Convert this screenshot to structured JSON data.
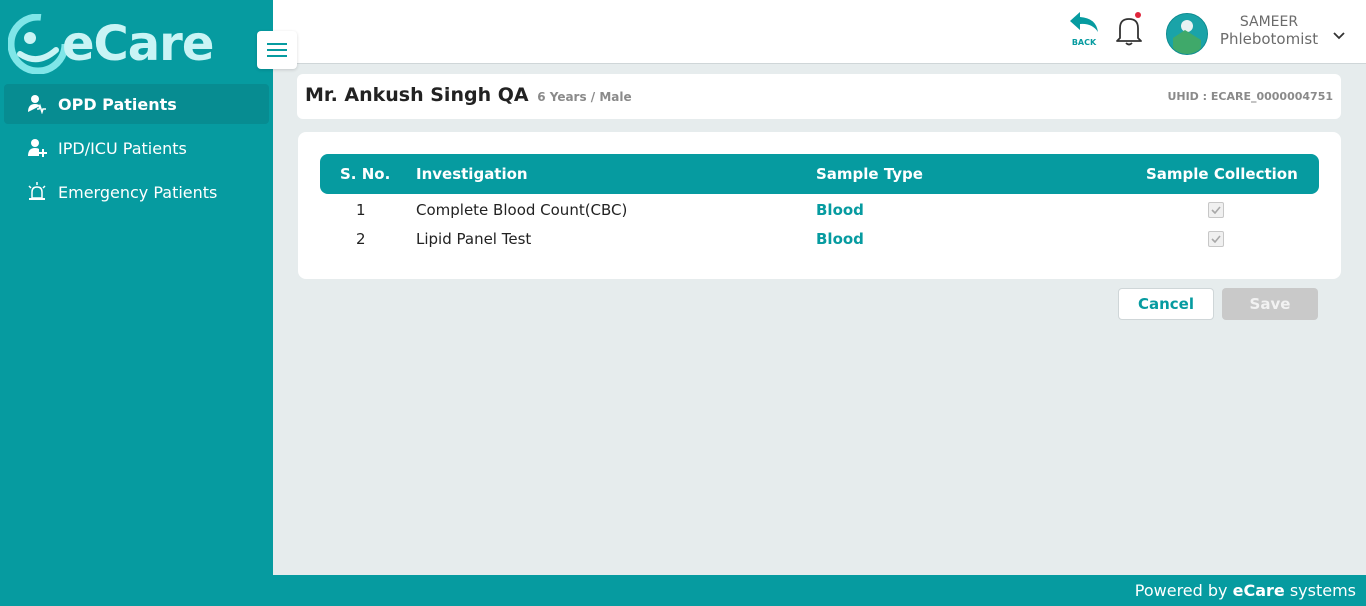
{
  "app": {
    "logo_text": "eCare"
  },
  "sidebar": {
    "items": [
      {
        "label": "OPD Patients",
        "icon": "user-pulse-icon",
        "active": true
      },
      {
        "label": "IPD/ICU Patients",
        "icon": "user-add-icon",
        "active": false
      },
      {
        "label": "Emergency Patients",
        "icon": "siren-icon",
        "active": false
      }
    ]
  },
  "header": {
    "back_label": "BACK",
    "user_name": "SAMEER",
    "user_role": "Phlebotomist"
  },
  "patient": {
    "name": "Mr. Ankush Singh QA",
    "meta": "6 Years / Male",
    "uhid": "UHID : ECARE_0000004751"
  },
  "table": {
    "headers": [
      "S. No.",
      "Investigation",
      "Sample Type",
      "Sample Collection"
    ],
    "rows": [
      {
        "sno": "1",
        "investigation": "Complete Blood Count(CBC)",
        "sample_type": "Blood",
        "collected": true
      },
      {
        "sno": "2",
        "investigation": "Lipid Panel Test",
        "sample_type": "Blood",
        "collected": true
      }
    ]
  },
  "actions": {
    "cancel_label": "Cancel",
    "save_label": "Save"
  },
  "footer": {
    "prefix": "Powered by ",
    "brand": "eCare",
    "suffix": " systems"
  },
  "colors": {
    "primary": "#069ba0",
    "sidebar_active": "#078c91",
    "background": "#e6eced",
    "notification_dot": "#e0263c"
  }
}
